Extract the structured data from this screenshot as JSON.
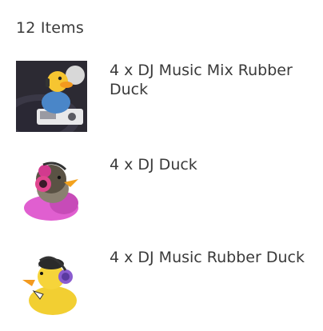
{
  "cart": {
    "count_label": "12 Items",
    "items": [
      {
        "name": "4 x DJ Music Mix Rubber Duck",
        "icon": "dj-mix-duck-image"
      },
      {
        "name": "4 x DJ Duck",
        "icon": "dj-duck-image"
      },
      {
        "name": "4 x DJ Music Rubber Duck",
        "icon": "dj-music-duck-image"
      }
    ]
  }
}
